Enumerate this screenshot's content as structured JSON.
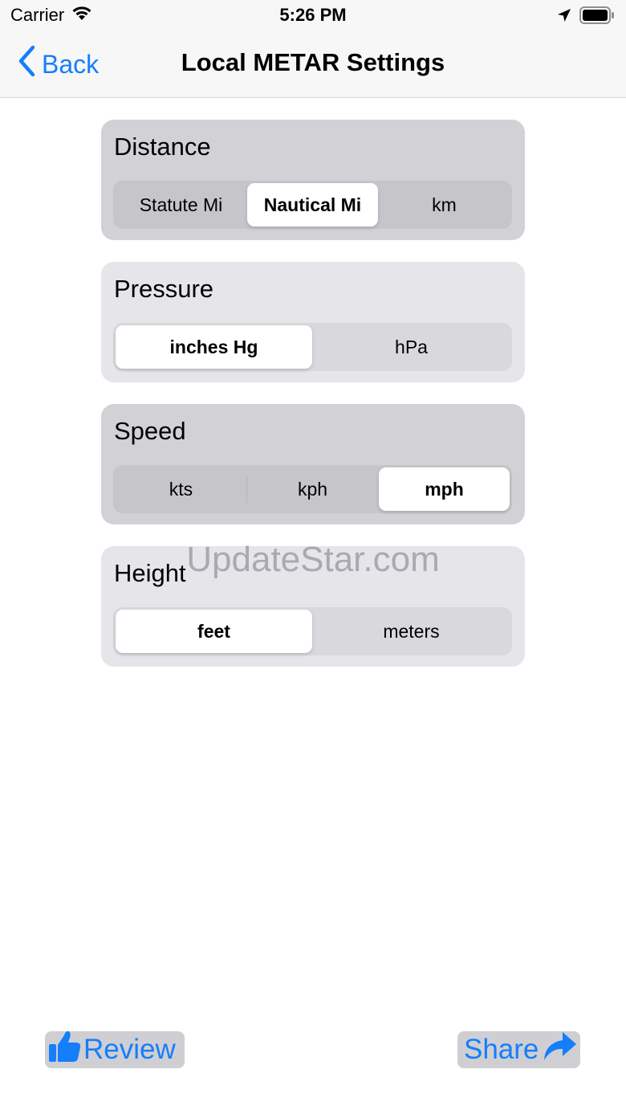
{
  "status_bar": {
    "carrier": "Carrier",
    "time": "5:26 PM",
    "icons": [
      "wifi-icon",
      "location-arrow-icon",
      "battery-icon"
    ]
  },
  "nav": {
    "back_label": "Back",
    "title": "Local METAR Settings"
  },
  "settings": {
    "distance": {
      "title": "Distance",
      "options": [
        "Statute Mi",
        "Nautical Mi",
        "km"
      ],
      "selected": "Nautical Mi"
    },
    "pressure": {
      "title": "Pressure",
      "options": [
        "inches Hg",
        "hPa"
      ],
      "selected": "inches Hg"
    },
    "speed": {
      "title": "Speed",
      "options": [
        "kts",
        "kph",
        "mph"
      ],
      "selected": "mph"
    },
    "height": {
      "title": "Height",
      "options": [
        "feet",
        "meters"
      ],
      "selected": "feet"
    }
  },
  "watermark": "UpdateStar.com",
  "footer": {
    "review_label": "Review",
    "share_label": "Share"
  },
  "colors": {
    "accent": "#157efb",
    "card_dark": "#d2d2d6",
    "card_light": "#e5e5ea",
    "bar_background": "#f7f7f7"
  }
}
